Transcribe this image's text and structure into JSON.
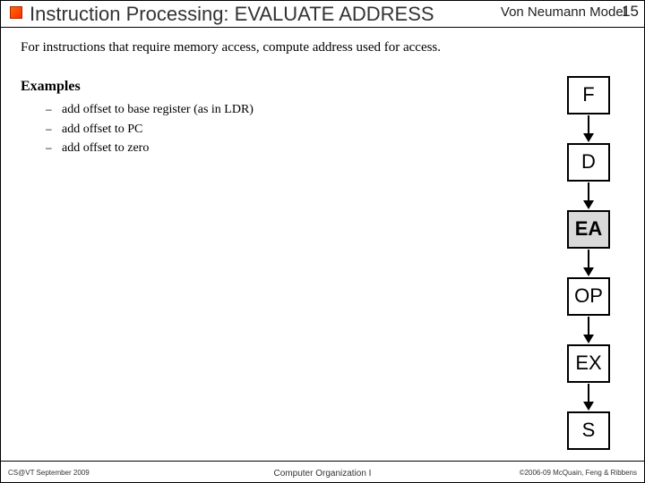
{
  "header": {
    "title": "Instruction Processing:  EVALUATE ADDRESS",
    "right_label": "Von Neumann Model",
    "slide_number": "15"
  },
  "body": {
    "intro": "For instructions that require memory access, compute address used for access.",
    "examples_label": "Examples",
    "examples": [
      "add offset to base register (as in LDR)",
      "add offset to PC",
      "add offset to zero"
    ]
  },
  "pipeline": {
    "stages": [
      "F",
      "D",
      "EA",
      "OP",
      "EX",
      "S"
    ],
    "active": "EA"
  },
  "footer": {
    "left": "CS@VT September 2009",
    "center": "Computer Organization I",
    "right": "©2006-09  McQuain, Feng & Ribbens"
  }
}
